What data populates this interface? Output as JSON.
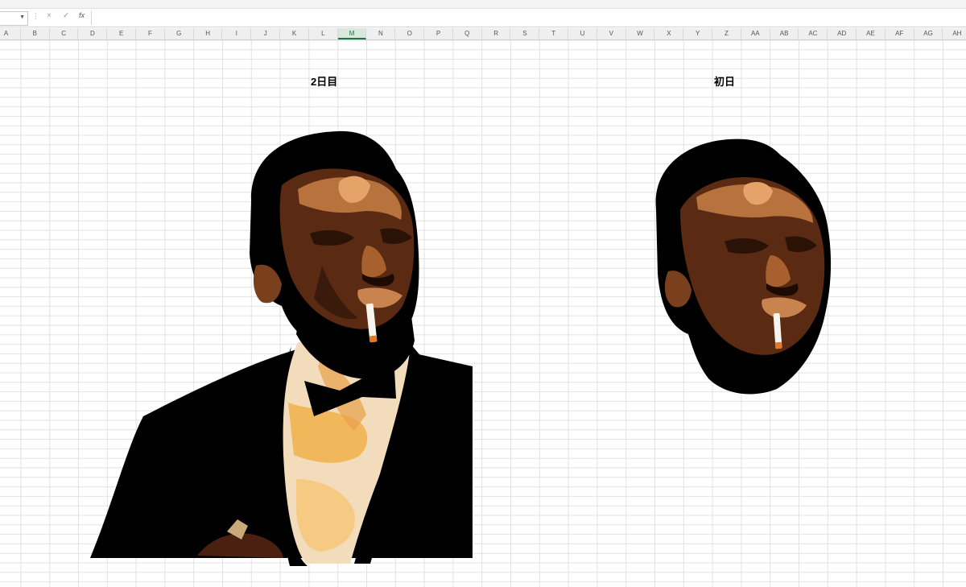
{
  "formula_bar": {
    "name_box_value": "",
    "cancel_icon": "×",
    "enter_icon": "✓",
    "fx_label": "fx",
    "formula_value": ""
  },
  "columns": [
    "A",
    "B",
    "C",
    "D",
    "E",
    "F",
    "G",
    "H",
    "I",
    "J",
    "K",
    "L",
    "M",
    "N",
    "O",
    "P",
    "Q",
    "R",
    "S",
    "T",
    "U",
    "V",
    "W",
    "X",
    "Y",
    "Z",
    "AA",
    "AB",
    "AC",
    "AD",
    "AE",
    "AF",
    "AG",
    "AH"
  ],
  "selected_column": "M",
  "sheet": {
    "title_left": "2日目",
    "title_right": "初日"
  },
  "colors": {
    "grid_line": "#e2e2e2",
    "header_bg": "#efefef",
    "selected_accent": "#217346",
    "suit": "#000000",
    "skin_dark": "#3a1e0f",
    "skin_mid": "#7a3f1d",
    "skin_light": "#c8834f"
  }
}
